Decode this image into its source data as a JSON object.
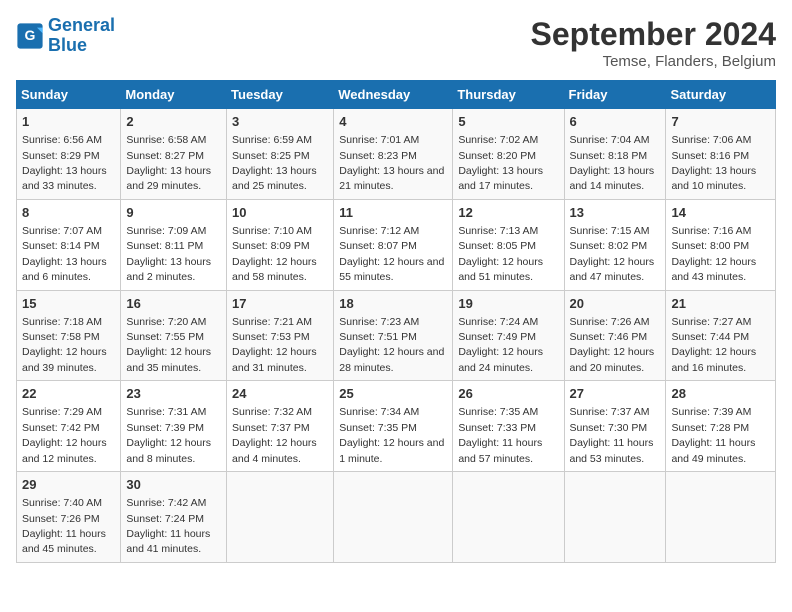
{
  "logo": {
    "line1": "General",
    "line2": "Blue"
  },
  "title": "September 2024",
  "subtitle": "Temse, Flanders, Belgium",
  "days_of_week": [
    "Sunday",
    "Monday",
    "Tuesday",
    "Wednesday",
    "Thursday",
    "Friday",
    "Saturday"
  ],
  "weeks": [
    [
      {
        "day": 1,
        "info": "Sunrise: 6:56 AM\nSunset: 8:29 PM\nDaylight: 13 hours and 33 minutes."
      },
      {
        "day": 2,
        "info": "Sunrise: 6:58 AM\nSunset: 8:27 PM\nDaylight: 13 hours and 29 minutes."
      },
      {
        "day": 3,
        "info": "Sunrise: 6:59 AM\nSunset: 8:25 PM\nDaylight: 13 hours and 25 minutes."
      },
      {
        "day": 4,
        "info": "Sunrise: 7:01 AM\nSunset: 8:23 PM\nDaylight: 13 hours and 21 minutes."
      },
      {
        "day": 5,
        "info": "Sunrise: 7:02 AM\nSunset: 8:20 PM\nDaylight: 13 hours and 17 minutes."
      },
      {
        "day": 6,
        "info": "Sunrise: 7:04 AM\nSunset: 8:18 PM\nDaylight: 13 hours and 14 minutes."
      },
      {
        "day": 7,
        "info": "Sunrise: 7:06 AM\nSunset: 8:16 PM\nDaylight: 13 hours and 10 minutes."
      }
    ],
    [
      {
        "day": 8,
        "info": "Sunrise: 7:07 AM\nSunset: 8:14 PM\nDaylight: 13 hours and 6 minutes."
      },
      {
        "day": 9,
        "info": "Sunrise: 7:09 AM\nSunset: 8:11 PM\nDaylight: 13 hours and 2 minutes."
      },
      {
        "day": 10,
        "info": "Sunrise: 7:10 AM\nSunset: 8:09 PM\nDaylight: 12 hours and 58 minutes."
      },
      {
        "day": 11,
        "info": "Sunrise: 7:12 AM\nSunset: 8:07 PM\nDaylight: 12 hours and 55 minutes."
      },
      {
        "day": 12,
        "info": "Sunrise: 7:13 AM\nSunset: 8:05 PM\nDaylight: 12 hours and 51 minutes."
      },
      {
        "day": 13,
        "info": "Sunrise: 7:15 AM\nSunset: 8:02 PM\nDaylight: 12 hours and 47 minutes."
      },
      {
        "day": 14,
        "info": "Sunrise: 7:16 AM\nSunset: 8:00 PM\nDaylight: 12 hours and 43 minutes."
      }
    ],
    [
      {
        "day": 15,
        "info": "Sunrise: 7:18 AM\nSunset: 7:58 PM\nDaylight: 12 hours and 39 minutes."
      },
      {
        "day": 16,
        "info": "Sunrise: 7:20 AM\nSunset: 7:55 PM\nDaylight: 12 hours and 35 minutes."
      },
      {
        "day": 17,
        "info": "Sunrise: 7:21 AM\nSunset: 7:53 PM\nDaylight: 12 hours and 31 minutes."
      },
      {
        "day": 18,
        "info": "Sunrise: 7:23 AM\nSunset: 7:51 PM\nDaylight: 12 hours and 28 minutes."
      },
      {
        "day": 19,
        "info": "Sunrise: 7:24 AM\nSunset: 7:49 PM\nDaylight: 12 hours and 24 minutes."
      },
      {
        "day": 20,
        "info": "Sunrise: 7:26 AM\nSunset: 7:46 PM\nDaylight: 12 hours and 20 minutes."
      },
      {
        "day": 21,
        "info": "Sunrise: 7:27 AM\nSunset: 7:44 PM\nDaylight: 12 hours and 16 minutes."
      }
    ],
    [
      {
        "day": 22,
        "info": "Sunrise: 7:29 AM\nSunset: 7:42 PM\nDaylight: 12 hours and 12 minutes."
      },
      {
        "day": 23,
        "info": "Sunrise: 7:31 AM\nSunset: 7:39 PM\nDaylight: 12 hours and 8 minutes."
      },
      {
        "day": 24,
        "info": "Sunrise: 7:32 AM\nSunset: 7:37 PM\nDaylight: 12 hours and 4 minutes."
      },
      {
        "day": 25,
        "info": "Sunrise: 7:34 AM\nSunset: 7:35 PM\nDaylight: 12 hours and 1 minute."
      },
      {
        "day": 26,
        "info": "Sunrise: 7:35 AM\nSunset: 7:33 PM\nDaylight: 11 hours and 57 minutes."
      },
      {
        "day": 27,
        "info": "Sunrise: 7:37 AM\nSunset: 7:30 PM\nDaylight: 11 hours and 53 minutes."
      },
      {
        "day": 28,
        "info": "Sunrise: 7:39 AM\nSunset: 7:28 PM\nDaylight: 11 hours and 49 minutes."
      }
    ],
    [
      {
        "day": 29,
        "info": "Sunrise: 7:40 AM\nSunset: 7:26 PM\nDaylight: 11 hours and 45 minutes."
      },
      {
        "day": 30,
        "info": "Sunrise: 7:42 AM\nSunset: 7:24 PM\nDaylight: 11 hours and 41 minutes."
      },
      null,
      null,
      null,
      null,
      null
    ]
  ]
}
